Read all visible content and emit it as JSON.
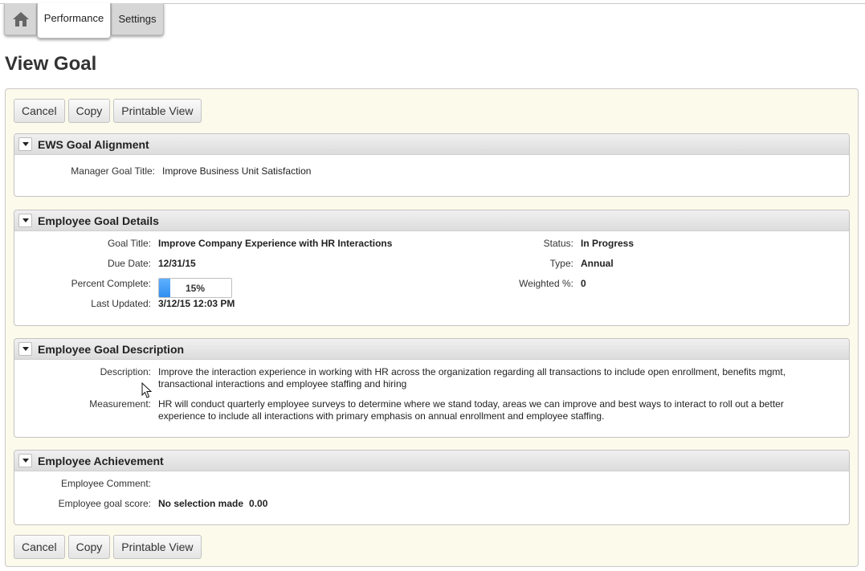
{
  "tabs": {
    "home_icon": "home-icon",
    "performance": "Performance",
    "settings": "Settings"
  },
  "page_title": "View Goal",
  "buttons": {
    "cancel": "Cancel",
    "copy": "Copy",
    "printable_view": "Printable View"
  },
  "sections": {
    "alignment": {
      "title": "EWS Goal Alignment",
      "manager_goal_title_label": "Manager Goal Title:",
      "manager_goal_title": "Improve Business Unit Satisfaction"
    },
    "details": {
      "title": "Employee Goal Details",
      "goal_title_label": "Goal Title:",
      "goal_title": "Improve Company Experience with HR Interactions",
      "due_date_label": "Due Date:",
      "due_date": "12/31/15",
      "percent_label": "Percent Complete:",
      "percent_text": "15%",
      "percent_value": 15,
      "last_updated_label": "Last Updated:",
      "last_updated": "3/12/15 12:03 PM",
      "status_label": "Status:",
      "status": "In Progress",
      "type_label": "Type:",
      "type": "Annual",
      "weighted_label": "Weighted %:",
      "weighted": "0"
    },
    "description": {
      "title": "Employee Goal Description",
      "description_label": "Description:",
      "description": "Improve the interaction experience in working with HR across the organization regarding all transactions to include open enrollment, benefits mgmt, transactional interactions and employee staffing and hiring",
      "measurement_label": "Measurement:",
      "measurement": "HR will conduct quarterly employee surveys to determine where we stand today, areas we can improve and best ways to interact to roll out a better experience to include all interactions with primary emphasis on annual enrollment and employee staffing."
    },
    "achievement": {
      "title": "Employee Achievement",
      "comment_label": "Employee Comment:",
      "comment": "",
      "score_label": "Employee goal score:",
      "score_text": "No selection made",
      "score_value": "0.00"
    }
  },
  "colors": {
    "panel_background": "#fcfaeb",
    "progress_fill": "#3d9af5",
    "tab_background": "#d6d6d6"
  }
}
